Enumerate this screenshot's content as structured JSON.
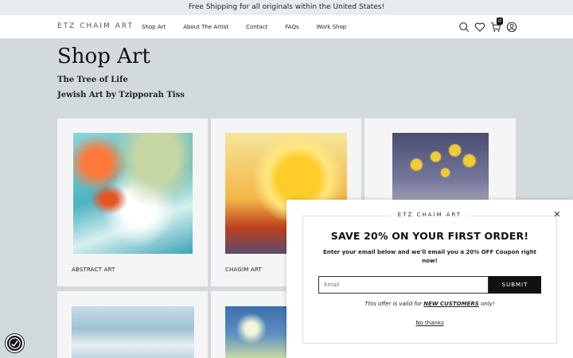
{
  "announcement": "Free Shipping for all originals within the United States!",
  "header": {
    "logo": "ETZ CHAIM ART",
    "nav": [
      "Shop Art",
      "About The Artist",
      "Contact",
      "FAQs",
      "Work Shop"
    ],
    "icons": [
      "search-icon",
      "heart-icon",
      "cart-icon",
      "account-icon"
    ],
    "cart_count": "0"
  },
  "page": {
    "title": "Shop Art",
    "subtitle1": "The Tree of Life",
    "subtitle2": "Jewish Art by Tzipporah Tiss"
  },
  "products": [
    {
      "label": "ABSTRACT ART"
    },
    {
      "label": "CHAGIM ART"
    },
    {
      "label": ""
    },
    {
      "label": ""
    },
    {
      "label": ""
    }
  ],
  "popup": {
    "brand": "ETZ CHAIM ART",
    "title": "SAVE 20% ON YOUR FIRST ORDER!",
    "text": "Enter your email below and we'll email you a 20% OFF Coupon right now!",
    "email_placeholder": "Email",
    "submit": "SUBMIT",
    "offer_prefix": "This offer is valid for",
    "offer_highlight": "NEW CUSTOMERS",
    "offer_suffix": "only!",
    "dismiss": "No thanks"
  },
  "colors": {
    "accent": "#111111",
    "background": "#d3dadd"
  }
}
